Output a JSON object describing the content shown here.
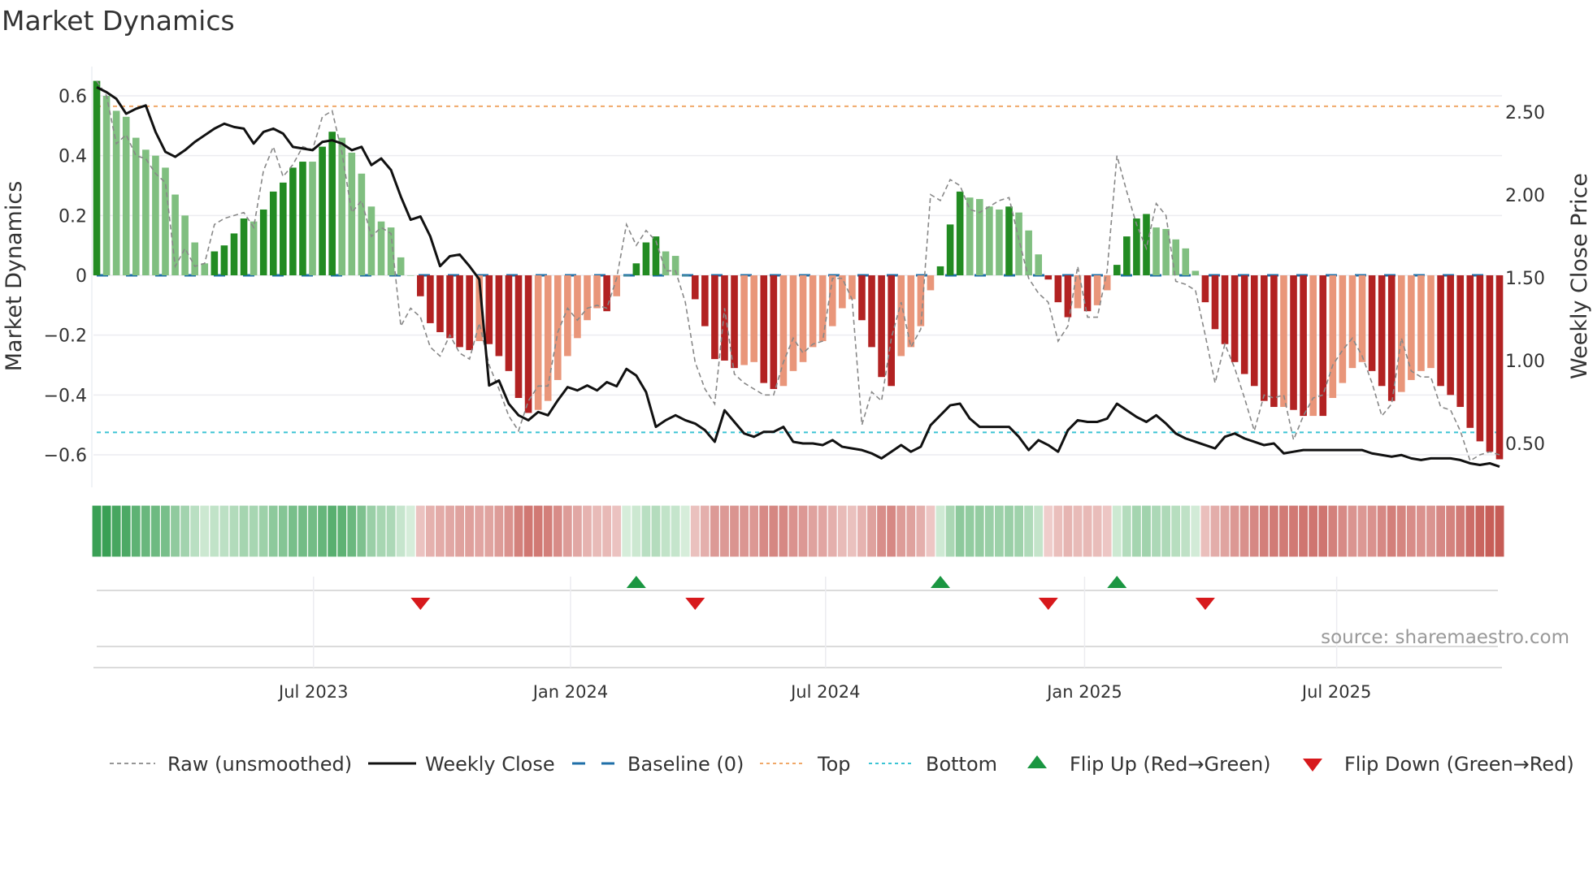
{
  "title": "Market Dynamics",
  "source": "source: sharemaestro.com",
  "colors": {
    "bar_pos_strong": "#228b22",
    "bar_pos_weak": "#80bf80",
    "bar_neg_strong": "#b22222",
    "bar_neg_weak": "#e9967a",
    "price": "#111111",
    "raw": "#888888",
    "baseline": "#1f6fa8",
    "top": "#f0a868",
    "bottom": "#3cc4d4",
    "flip_up": "#1a9641",
    "flip_down": "#d7191c"
  },
  "legend": [
    {
      "label": "Raw (unsmoothed)",
      "icon": "dashed-gray-line"
    },
    {
      "label": "Weekly Close",
      "icon": "solid-black-line"
    },
    {
      "label": "Baseline (0)",
      "icon": "dashed-blue-line"
    },
    {
      "label": "Top",
      "icon": "dotted-orange-line"
    },
    {
      "label": "Bottom",
      "icon": "dotted-cyan-line"
    },
    {
      "label": "Flip Up (Red→Green)",
      "icon": "triangle-up-green"
    },
    {
      "label": "Flip Down (Green→Red)",
      "icon": "triangle-down-red"
    }
  ],
  "chart_data": {
    "type": "bar",
    "title": "Market Dynamics",
    "ylabel": "Market Dynamics",
    "y2label": "Weekly Close Price",
    "ylim": [
      -0.7,
      0.7
    ],
    "y2lim": [
      0.33,
      2.72
    ],
    "yticks": [
      0.6,
      0.4,
      0.2,
      0,
      -0.2,
      -0.4,
      -0.6
    ],
    "ytick_labels": [
      "0.6",
      "0.4",
      "0.2",
      "0",
      "−0.2",
      "−0.4",
      "−0.6"
    ],
    "y2ticks": [
      2.5,
      2.0,
      1.5,
      1.0,
      0.5
    ],
    "y2tick_labels": [
      "2.50",
      "2.00",
      "1.50",
      "1.00",
      "0.50"
    ],
    "xticks_week_index": [
      22.1,
      48.3,
      74.3,
      100.7,
      126.4
    ],
    "xtick_labels": [
      "Jul 2023",
      "Jan 2024",
      "Jul 2024",
      "Jan 2025",
      "Jul 2025"
    ],
    "grid": true,
    "legend_position": "bottom",
    "reference_lines": {
      "baseline": 0,
      "top": 0.565,
      "bottom": -0.525
    },
    "bars": [
      0.65,
      0.6,
      0.55,
      0.53,
      0.46,
      0.42,
      0.4,
      0.36,
      0.27,
      0.2,
      0.11,
      0.04,
      0.08,
      0.1,
      0.14,
      0.19,
      0.18,
      0.22,
      0.28,
      0.31,
      0.36,
      0.38,
      0.38,
      0.43,
      0.48,
      0.46,
      0.41,
      0.34,
      0.23,
      0.18,
      0.16,
      0.06,
      0.0,
      -0.07,
      -0.16,
      -0.19,
      -0.21,
      -0.24,
      -0.25,
      -0.22,
      -0.23,
      -0.27,
      -0.32,
      -0.41,
      -0.46,
      -0.45,
      -0.42,
      -0.35,
      -0.27,
      -0.21,
      -0.15,
      -0.11,
      -0.12,
      -0.07,
      0.0,
      0.04,
      0.11,
      0.13,
      0.08,
      0.065,
      0.0,
      -0.08,
      -0.17,
      -0.28,
      -0.285,
      -0.31,
      -0.3,
      -0.29,
      -0.36,
      -0.38,
      -0.37,
      -0.32,
      -0.29,
      -0.24,
      -0.22,
      -0.17,
      -0.11,
      -0.08,
      -0.15,
      -0.24,
      -0.34,
      -0.37,
      -0.27,
      -0.24,
      -0.17,
      -0.05,
      0.03,
      0.17,
      0.28,
      0.26,
      0.255,
      0.23,
      0.22,
      0.23,
      0.21,
      0.15,
      0.07,
      -0.014,
      -0.09,
      -0.14,
      -0.11,
      -0.12,
      -0.1,
      -0.05,
      0.035,
      0.13,
      0.19,
      0.205,
      0.16,
      0.155,
      0.12,
      0.09,
      0.015,
      -0.09,
      -0.18,
      -0.23,
      -0.29,
      -0.33,
      -0.37,
      -0.42,
      -0.44,
      -0.44,
      -0.45,
      -0.47,
      -0.47,
      -0.47,
      -0.41,
      -0.36,
      -0.31,
      -0.29,
      -0.32,
      -0.37,
      -0.42,
      -0.39,
      -0.35,
      -0.32,
      -0.31,
      -0.37,
      -0.4,
      -0.44,
      -0.51,
      -0.555,
      -0.59,
      -0.615
    ],
    "bar_strength": [
      "D",
      "L",
      "L",
      "L",
      "L",
      "L",
      "L",
      "L",
      "L",
      "L",
      "L",
      "L",
      "D",
      "D",
      "D",
      "D",
      "L",
      "D",
      "D",
      "D",
      "D",
      "D",
      "L",
      "D",
      "D",
      "L",
      "L",
      "L",
      "L",
      "L",
      "L",
      "L",
      "L",
      "D",
      "D",
      "D",
      "D",
      "D",
      "D",
      "L",
      "D",
      "D",
      "D",
      "D",
      "D",
      "L",
      "L",
      "L",
      "L",
      "L",
      "L",
      "L",
      "D",
      "L",
      "L",
      "D",
      "D",
      "D",
      "L",
      "L",
      "L",
      "D",
      "D",
      "D",
      "D",
      "D",
      "L",
      "L",
      "D",
      "D",
      "L",
      "L",
      "L",
      "L",
      "L",
      "L",
      "L",
      "L",
      "D",
      "D",
      "D",
      "D",
      "L",
      "L",
      "L",
      "L",
      "D",
      "D",
      "D",
      "L",
      "L",
      "L",
      "L",
      "D",
      "L",
      "L",
      "L",
      "D",
      "D",
      "D",
      "L",
      "D",
      "L",
      "L",
      "D",
      "D",
      "D",
      "D",
      "L",
      "L",
      "L",
      "L",
      "L",
      "D",
      "D",
      "D",
      "D",
      "D",
      "D",
      "D",
      "D",
      "L",
      "D",
      "D",
      "L",
      "D",
      "L",
      "L",
      "L",
      "L",
      "D",
      "D",
      "D",
      "L",
      "L",
      "L",
      "L",
      "D",
      "D",
      "D",
      "D",
      "D",
      "D",
      "D"
    ],
    "weekly_close": [
      2.65,
      2.62,
      2.58,
      2.49,
      2.52,
      2.54,
      2.38,
      2.26,
      2.23,
      2.27,
      2.32,
      2.36,
      2.4,
      2.43,
      2.41,
      2.4,
      2.31,
      2.38,
      2.4,
      2.37,
      2.29,
      2.28,
      2.27,
      2.32,
      2.33,
      2.31,
      2.27,
      2.29,
      2.18,
      2.22,
      2.15,
      1.99,
      1.85,
      1.87,
      1.75,
      1.57,
      1.63,
      1.64,
      1.57,
      1.49,
      0.85,
      0.88,
      0.74,
      0.67,
      0.64,
      0.69,
      0.67,
      0.76,
      0.84,
      0.82,
      0.85,
      0.82,
      0.87,
      0.845,
      0.95,
      0.91,
      0.81,
      0.6,
      0.64,
      0.67,
      0.64,
      0.62,
      0.58,
      0.51,
      0.7,
      0.63,
      0.56,
      0.54,
      0.57,
      0.57,
      0.6,
      0.51,
      0.5,
      0.5,
      0.49,
      0.52,
      0.48,
      0.47,
      0.46,
      0.44,
      0.41,
      0.45,
      0.49,
      0.45,
      0.48,
      0.61,
      0.67,
      0.73,
      0.74,
      0.65,
      0.6,
      0.6,
      0.6,
      0.6,
      0.54,
      0.46,
      0.52,
      0.49,
      0.45,
      0.58,
      0.64,
      0.63,
      0.63,
      0.65,
      0.74,
      0.7,
      0.66,
      0.63,
      0.67,
      0.62,
      0.56,
      0.53,
      0.51,
      0.49,
      0.47,
      0.54,
      0.56,
      0.53,
      0.51,
      0.49,
      0.5,
      0.44,
      0.45,
      0.46,
      0.46,
      0.46,
      0.46,
      0.46,
      0.46,
      0.46,
      0.44,
      0.43,
      0.42,
      0.43,
      0.41,
      0.4,
      0.41,
      0.41,
      0.41,
      0.4,
      0.38,
      0.37,
      0.38,
      0.36
    ],
    "raw": [
      0.65,
      0.6,
      0.44,
      0.47,
      0.4,
      0.39,
      0.34,
      0.31,
      0.03,
      0.09,
      0.03,
      0.04,
      0.17,
      0.19,
      0.2,
      0.21,
      0.16,
      0.35,
      0.43,
      0.33,
      0.37,
      0.43,
      0.42,
      0.53,
      0.55,
      0.41,
      0.21,
      0.25,
      0.13,
      0.16,
      0.14,
      -0.17,
      -0.11,
      -0.14,
      -0.24,
      -0.27,
      -0.2,
      -0.26,
      -0.28,
      -0.16,
      -0.3,
      -0.38,
      -0.47,
      -0.52,
      -0.42,
      -0.37,
      -0.37,
      -0.19,
      -0.11,
      -0.15,
      -0.11,
      -0.1,
      -0.11,
      -0.01,
      0.17,
      0.1,
      0.15,
      0.115,
      0.015,
      0.015,
      -0.09,
      -0.29,
      -0.38,
      -0.43,
      -0.11,
      -0.33,
      -0.36,
      -0.38,
      -0.4,
      -0.4,
      -0.29,
      -0.21,
      -0.26,
      -0.23,
      -0.22,
      -0.01,
      -0.01,
      -0.08,
      -0.5,
      -0.39,
      -0.42,
      -0.21,
      -0.09,
      -0.24,
      -0.18,
      0.27,
      0.25,
      0.32,
      0.3,
      0.22,
      0.21,
      0.23,
      0.25,
      0.26,
      0.12,
      -0.01,
      -0.06,
      -0.09,
      -0.22,
      -0.17,
      0.03,
      -0.14,
      -0.14,
      0.015,
      0.4,
      0.28,
      0.17,
      0.09,
      0.24,
      0.2,
      -0.02,
      -0.03,
      -0.05,
      -0.2,
      -0.36,
      -0.23,
      -0.31,
      -0.41,
      -0.52,
      -0.4,
      -0.41,
      -0.4,
      -0.55,
      -0.47,
      -0.41,
      -0.4,
      -0.3,
      -0.25,
      -0.21,
      -0.27,
      -0.36,
      -0.47,
      -0.43,
      -0.21,
      -0.32,
      -0.34,
      -0.34,
      -0.44,
      -0.45,
      -0.52,
      -0.62,
      -0.6,
      -0.59,
      -0.6
    ],
    "flip_up_week_index": [
      55,
      86,
      104
    ],
    "flip_down_week_index": [
      33,
      61,
      97,
      113
    ]
  }
}
